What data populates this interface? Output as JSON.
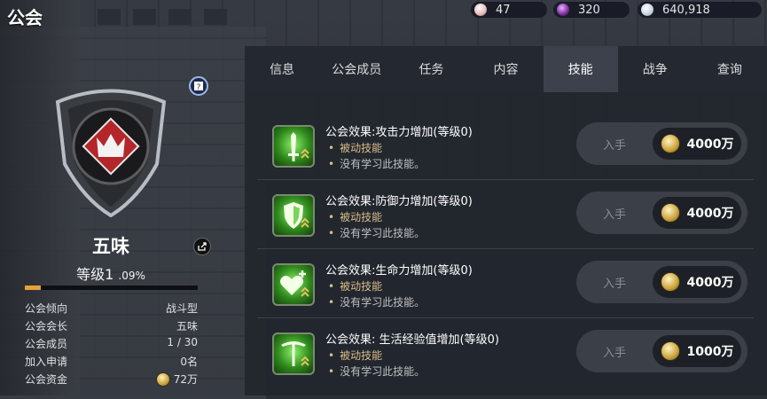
{
  "title": "公会",
  "currencies": [
    {
      "icon": "pearl-icon",
      "color": "#e8b8b8",
      "value": "47"
    },
    {
      "icon": "purple-gem-icon",
      "color": "#7a2a9a",
      "value": "320"
    },
    {
      "icon": "silver-coin-icon",
      "color": "#c8d2e0",
      "value": "640,918"
    }
  ],
  "guild": {
    "name": "五味",
    "level_text": "等级1",
    "level_pct": ".09%",
    "xp_fraction": 0.09,
    "info": [
      {
        "label": "公会倾向",
        "value": "战斗型"
      },
      {
        "label": "公会会长",
        "value": "五味"
      },
      {
        "label": "公会成员",
        "value": "1 / 30"
      },
      {
        "label": "加入申请",
        "value": "0名"
      },
      {
        "label": "公会资金",
        "value": "72万"
      }
    ]
  },
  "tabs": [
    "信息",
    "公会成员",
    "任务",
    "内容",
    "技能",
    "战争",
    "查询"
  ],
  "active_tab": 4,
  "skills": [
    {
      "name": "公会效果:攻击力增加(等级0)",
      "icon": "sword-icon",
      "type": "被动技能",
      "status": "没有学习此技能。",
      "buy_label": "入手",
      "price": "4000万"
    },
    {
      "name": "公会效果:防御力增加(等级0)",
      "icon": "shield-icon",
      "type": "被动技能",
      "status": "没有学习此技能。",
      "buy_label": "入手",
      "price": "4000万"
    },
    {
      "name": "公会效果:生命力增加(等级0)",
      "icon": "heart-plus-icon",
      "type": "被动技能",
      "status": "没有学习此技能。",
      "buy_label": "入手",
      "price": "4000万"
    },
    {
      "name": "公会效果: 生活经验值增加(等级0)",
      "icon": "pickaxe-icon",
      "type": "被动技能",
      "status": "没有学习此技能。",
      "buy_label": "入手",
      "price": "1000万"
    }
  ]
}
